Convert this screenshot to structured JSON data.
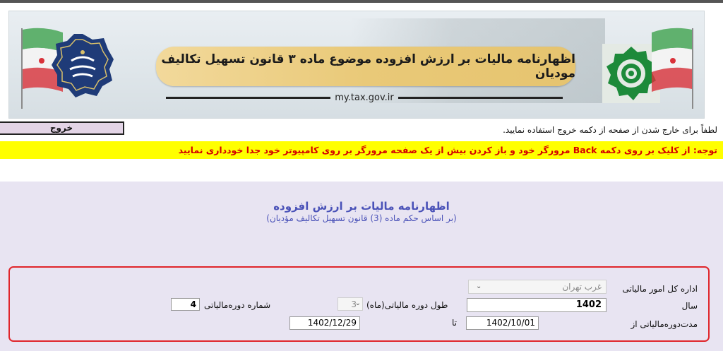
{
  "banner": {
    "title": "اظهارنامه مالیات بر ارزش افزوده موضوع ماده ۳ قانون تسهیل تکالیف مودیان",
    "url": "my.tax.gov.ir"
  },
  "exit": {
    "button_label": "خروج",
    "note": "لطفاً برای خارج شدن از صفحه از دکمه خروج استفاده نمایید."
  },
  "warning": {
    "text": "توجه: از کلیک بر روی دکمه Back مرورگر خود و باز کردن بیش از یک صفحه مرورگر بر روی کامپیوتر خود جدا خودداری نمایید"
  },
  "form": {
    "title": "اظهارنامه مالیات بر ارزش افزوده",
    "subtitle": "(بر اساس حکم ماده (3) قانون تسهیل تکالیف مؤدیان)",
    "admin_label": "اداره کل امور مالیاتی",
    "admin_value": "غرب تهران",
    "year_label": "سال",
    "year_value": "1402",
    "period_length_label": "طول دوره مالیاتی(ماه)",
    "period_length_value": "3",
    "period_number_label": "شماره دوره‌مالیاتی",
    "period_number_value": "4",
    "period_from_label": "مدت‌دوره‌مالیاتی از",
    "period_from_value": "1402/10/01",
    "to_label": "تا",
    "period_to_value": "1402/12/29"
  },
  "colors": {
    "warning_bg": "#ffff00",
    "warning_text": "#d40000",
    "title_blue": "#4a52b8",
    "highlight_box": "#e0252b",
    "form_bg": "#e8e4f2"
  }
}
